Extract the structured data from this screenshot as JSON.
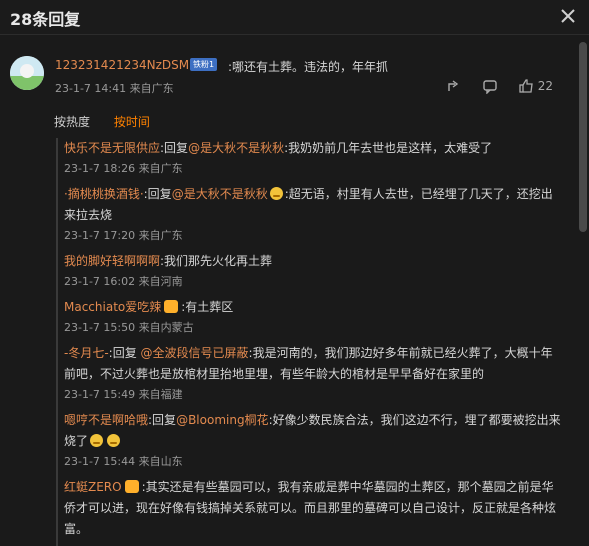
{
  "header": {
    "title": "28条回复"
  },
  "post": {
    "username": "123231421234NzDSM",
    "badge": "铁粉1",
    "text": ":哪还有土葬。违法的，年年抓",
    "time": "23-1-7 14:41",
    "location": "来自广东",
    "likes": "22"
  },
  "sort": {
    "hot": "按热度",
    "time": "按时间"
  },
  "replies": [
    {
      "user": "快乐不是无限供应",
      "pre": ":回复",
      "mention": "@是大秋不是秋秋",
      "text": ":我奶奶前几年去世也是这样，太难受了",
      "time": "23-1-7 18:26",
      "location": "来自广东"
    },
    {
      "user": "·摘桃桃换酒钱·",
      "pre": ":回复",
      "mention": "@是大秋不是秋秋",
      "text": ":超无语，村里有人去世，已经埋了几天了，还挖出来拉去烧",
      "time": "23-1-7 17:20",
      "location": "来自广东"
    },
    {
      "user": "我的脚好轻啊啊啊",
      "pre": "",
      "mention": "",
      "text": ":我们那先火化再土葬",
      "time": "23-1-7 16:02",
      "location": "来自河南"
    },
    {
      "user": "Macchiato爱吃辣",
      "pre": "",
      "mention": "",
      "text": ":有土葬区",
      "time": "23-1-7 15:50",
      "location": "来自内蒙古"
    },
    {
      "user": "-冬月七-",
      "pre": ":回复 ",
      "mention": "@全波段信号已屏蔽",
      "text": ":我是河南的，我们那边好多年前就已经火葬了，大概十年前吧，不过火葬也是放棺材里抬地里埋，有些年龄大的棺材是早早备好在家里的",
      "time": "23-1-7 15:49",
      "location": "来自福建"
    },
    {
      "user": "嗯哼不是啊哈哦",
      "pre": ":回复",
      "mention": "@Blooming桐花",
      "text": ":好像少数民族合法，我们这边不行，埋了都要被挖出来烧了",
      "time": "23-1-7 15:44",
      "location": "来自山东"
    },
    {
      "user": "红蜓ZERO",
      "pre": "",
      "mention": "",
      "text": ":其实还是有些墓园可以，我有亲戚是葬中华墓园的土葬区，那个墓园之前是华侨才可以进，现在好像有钱搞掉关系就可以。而且那里的墓碑可以自己设计，反正就是各种炫富。",
      "time": "",
      "location": ""
    }
  ]
}
